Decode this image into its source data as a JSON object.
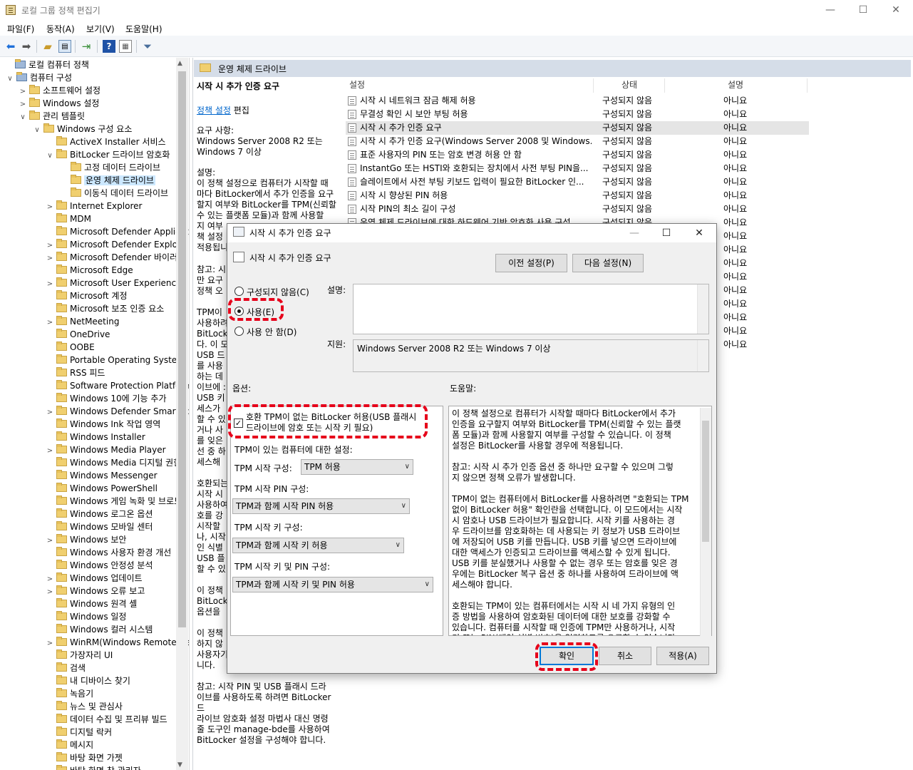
{
  "window": {
    "title": "로컬 그룹 정책 편집기",
    "min_glyph": "—",
    "max_glyph": "☐",
    "close_glyph": "✕"
  },
  "menu": [
    "파일(F)",
    "동작(A)",
    "보기(V)",
    "도움말(H)"
  ],
  "toolbar_icons": [
    "back-arrow-icon",
    "forward-arrow-icon",
    "up-folder-icon",
    "show-hide-tree-icon",
    "export-list-icon",
    "help-icon",
    "properties-icon",
    "filter-icon"
  ],
  "tree": [
    {
      "label": "로컬 컴퓨터 정책",
      "level": 0,
      "exp": ""
    },
    {
      "label": "컴퓨터 구성",
      "level": 1,
      "exp": "∨"
    },
    {
      "label": "소프트웨어 설정",
      "level": 2,
      "exp": ">"
    },
    {
      "label": "Windows 설정",
      "level": 2,
      "exp": ">"
    },
    {
      "label": "관리 템플릿",
      "level": 2,
      "exp": "∨"
    },
    {
      "label": "Windows 구성 요소",
      "level": 3,
      "exp": "∨"
    },
    {
      "label": "ActiveX Installer 서비스",
      "level": 4,
      "exp": ""
    },
    {
      "label": "BitLocker 드라이브 암호화",
      "level": 4,
      "exp": "∨"
    },
    {
      "label": "고정 데이터 드라이브",
      "level": 5,
      "exp": ""
    },
    {
      "label": "운영 체제 드라이브",
      "level": 5,
      "exp": "",
      "selected": true
    },
    {
      "label": "이동식 데이터 드라이브",
      "level": 5,
      "exp": ""
    },
    {
      "label": "Internet Explorer",
      "level": 4,
      "exp": ">"
    },
    {
      "label": "MDM",
      "level": 4,
      "exp": ""
    },
    {
      "label": "Microsoft Defender Application",
      "level": 4,
      "exp": ""
    },
    {
      "label": "Microsoft Defender Exploit",
      "level": 4,
      "exp": ">"
    },
    {
      "label": "Microsoft Defender 바이러",
      "level": 4,
      "exp": ">"
    },
    {
      "label": "Microsoft Edge",
      "level": 4,
      "exp": ""
    },
    {
      "label": "Microsoft User Experience",
      "level": 4,
      "exp": ">"
    },
    {
      "label": "Microsoft 계정",
      "level": 4,
      "exp": ""
    },
    {
      "label": "Microsoft 보조 인증 요소",
      "level": 4,
      "exp": ""
    },
    {
      "label": "NetMeeting",
      "level": 4,
      "exp": ">"
    },
    {
      "label": "OneDrive",
      "level": 4,
      "exp": ""
    },
    {
      "label": "OOBE",
      "level": 4,
      "exp": ""
    },
    {
      "label": "Portable Operating System",
      "level": 4,
      "exp": ""
    },
    {
      "label": "RSS 피드",
      "level": 4,
      "exp": ""
    },
    {
      "label": "Software Protection Platform",
      "level": 4,
      "exp": ""
    },
    {
      "label": "Windows 10에 기능 추가",
      "level": 4,
      "exp": ""
    },
    {
      "label": "Windows Defender SmartScreen",
      "level": 4,
      "exp": ">"
    },
    {
      "label": "Windows Ink 작업 영역",
      "level": 4,
      "exp": ""
    },
    {
      "label": "Windows Installer",
      "level": 4,
      "exp": ""
    },
    {
      "label": "Windows Media Player",
      "level": 4,
      "exp": ">"
    },
    {
      "label": "Windows Media 디지털 권한",
      "level": 4,
      "exp": ""
    },
    {
      "label": "Windows Messenger",
      "level": 4,
      "exp": ""
    },
    {
      "label": "Windows PowerShell",
      "level": 4,
      "exp": ""
    },
    {
      "label": "Windows 게임 녹화 및 브로드",
      "level": 4,
      "exp": ""
    },
    {
      "label": "Windows 로그온 옵션",
      "level": 4,
      "exp": ""
    },
    {
      "label": "Windows 모바일 센터",
      "level": 4,
      "exp": ""
    },
    {
      "label": "Windows 보안",
      "level": 4,
      "exp": ">"
    },
    {
      "label": "Windows 사용자 환경 개선",
      "level": 4,
      "exp": ""
    },
    {
      "label": "Windows 안정성 분석",
      "level": 4,
      "exp": ""
    },
    {
      "label": "Windows 업데이트",
      "level": 4,
      "exp": ">"
    },
    {
      "label": "Windows 오류 보고",
      "level": 4,
      "exp": ">"
    },
    {
      "label": "Windows 원격 셸",
      "level": 4,
      "exp": ""
    },
    {
      "label": "Windows 일정",
      "level": 4,
      "exp": ""
    },
    {
      "label": "Windows 컬러 시스템",
      "level": 4,
      "exp": ""
    },
    {
      "label": "WinRM(Windows Remote Management)",
      "level": 4,
      "exp": ">"
    },
    {
      "label": "가장자리 UI",
      "level": 4,
      "exp": ""
    },
    {
      "label": "검색",
      "level": 4,
      "exp": ""
    },
    {
      "label": "내 디바이스 찾기",
      "level": 4,
      "exp": ""
    },
    {
      "label": "녹음기",
      "level": 4,
      "exp": ""
    },
    {
      "label": "뉴스 및 관심사",
      "level": 4,
      "exp": ""
    },
    {
      "label": "데이터 수집 및 프리뷰 빌드",
      "level": 4,
      "exp": ""
    },
    {
      "label": "디지털 락커",
      "level": 4,
      "exp": ""
    },
    {
      "label": "메시지",
      "level": 4,
      "exp": ""
    },
    {
      "label": "바탕 화면 가젯",
      "level": 4,
      "exp": ""
    },
    {
      "label": "바탕 화면 창 관리자",
      "level": 4,
      "exp": ""
    }
  ],
  "content": {
    "folder_title": "운영 체제 드라이브",
    "desc_title": "시작 시 추가 인증 요구",
    "edit_link": "정책 설정",
    "edit_suffix": " 편집",
    "desc_req": "요구 사항:\nWindows Server 2008 R2 또는\nWindows 7 이상",
    "desc_body": "설명:\n이 정책 설정으로 컴퓨터가 시작할 때\n마다 BitLocker에서 추가 인증을 요구\n할지 여부와 BitLocker를 TPM(신뢰할\n수 있는 플랫폼 모듈)과 함께 사용할\n지 여부\n책 설정\n적용됩니",
    "desc_note": "참고: 시\n만 요구\n정책 오",
    "desc_tpm": "TPM이\n사용하려\nBitLock\n다. 이 모\nUSB 드\n를 사용\n하는 데\n이브에 :\nUSB 키\n세스가\n할 수 있\n거나 사\n를 잊은\n선 중 하\n세스해",
    "desc_compat": "호환되는\n시작 시\n사용하여\n호를 강\n시작할 \n나, 시작\n인 식별\nUSB 플\n할 수 있",
    "desc_tail1": "이 정책\nBitLock\n옵션을 ",
    "desc_tail2": "이 정책\n하지 않\n사용자기\n니다.",
    "desc_final": "참고: 시작 PIN 및 USB 플래시 드라\n이브를 사용하도록 하려면 BitLocker 드\n라이브 암호화 설정 마법사 대신 명령\n줄 도구인 manage-bde를 사용하여\nBitLocker 설정을 구성해야 합니다."
  },
  "columns": {
    "setting": "설정",
    "state": "상태",
    "comment": "설명"
  },
  "rows": [
    {
      "name": "시작 시 네트워크 잠금 해제 허용",
      "state": "구성되지 않음",
      "comment": "아니요"
    },
    {
      "name": "무결성 확인 시 보안 부팅 허용",
      "state": "구성되지 않음",
      "comment": "아니요"
    },
    {
      "name": "시작 시 추가 인증 요구",
      "state": "구성되지 않음",
      "comment": "아니요",
      "selected": true
    },
    {
      "name": "시작 시 추가 인증 요구(Windows Server 2008 및 Windows...",
      "state": "구성되지 않음",
      "comment": "아니요"
    },
    {
      "name": "표준 사용자의 PIN 또는 암호 변경 허용 안 함",
      "state": "구성되지 않음",
      "comment": "아니요"
    },
    {
      "name": "InstantGo 또는 HSTI와 호환되는 장치에서 사전 부팅 PIN을...",
      "state": "구성되지 않음",
      "comment": "아니요"
    },
    {
      "name": "슬레이트에서 사전 부팅 키보드 입력이 필요한 BitLocker 인...",
      "state": "구성되지 않음",
      "comment": "아니요"
    },
    {
      "name": "시작 시 향상된 PIN 허용",
      "state": "구성되지 않음",
      "comment": "아니요"
    },
    {
      "name": "시작 PIN의 최소 길이 구성",
      "state": "구성되지 않음",
      "comment": "아니요"
    },
    {
      "name": "운영 체제 드라이브에 대한 하드웨어 기반 암호화 사용 구성",
      "state": "구성되지 않음",
      "comment": "아니요"
    },
    {
      "name": "",
      "state": "",
      "comment": "아니요"
    },
    {
      "name": "",
      "state": "",
      "comment": "아니요"
    },
    {
      "name": "",
      "state": "",
      "comment": "아니요"
    },
    {
      "name": "",
      "state": "",
      "comment": "아니요"
    },
    {
      "name": "",
      "state": "",
      "comment": "아니요"
    },
    {
      "name": "",
      "state": "",
      "comment": "아니요"
    },
    {
      "name": "",
      "state": "",
      "comment": "아니요"
    },
    {
      "name": "",
      "state": "",
      "comment": "아니요"
    },
    {
      "name": "",
      "state": "",
      "comment": "아니요"
    }
  ],
  "dialog": {
    "title": "시작 시 추가 인증 요구",
    "heading": "시작 시 추가 인증 요구",
    "prev_button": "이전 설정(P)",
    "next_button": "다음 설정(N)",
    "radio_not_configured": "구성되지 않음(C)",
    "radio_enabled": "사용(E)",
    "radio_disabled": "사용 안 함(D)",
    "selected_radio": "enabled",
    "comment_label": "설명:",
    "comment_value": "",
    "support_label": "지원:",
    "support_value": "Windows Server 2008 R2 또는 Windows 7 이상",
    "options_label": "옵션:",
    "help_label": "도움말:",
    "allow_no_tpm_line1": "호환 TPM이 없는 BitLocker 허용(USB 플래시",
    "allow_no_tpm_line2": "드라이브에 암호 또는 시작 키 필요)",
    "allow_no_tpm_checked": true,
    "tpm_settings_heading": "TPM이 있는 컴퓨터에 대한 설정:",
    "tpm_startup_label": "TPM 시작 구성:",
    "tpm_startup_value": "TPM 허용",
    "tpm_pin_label": "TPM 시작 PIN 구성:",
    "tpm_pin_value": "TPM과 함께 시작 PIN 허용",
    "tpm_key_label": "TPM 시작 키 구성:",
    "tpm_key_value": "TPM과 함께 시작 키 허용",
    "tpm_key_pin_label": "TPM 시작 키 및 PIN 구성:",
    "tpm_key_pin_value": "TPM과 함께 시작 키 및 PIN 허용",
    "help_text": "이 정책 설정으로 컴퓨터가 시작할 때마다 BitLocker에서 추가\n인증을 요구할지 여부와 BitLocker를 TPM(신뢰할 수 있는 플랫\n폼 모듈)과 함께 사용할지 여부를 구성할 수 있습니다. 이 정책\n설정은 BitLocker를 사용할 경우에 적용됩니다.\n\n참고: 시작 시 추가 인증 옵션 중 하나만 요구할 수 있으며 그렇\n지 않으면 정책 오류가 발생합니다.\n\nTPM이 없는 컴퓨터에서 BitLocker를 사용하려면 \"호환되는 TPM\n없이 BitLocker 허용\" 확인란을 선택합니다. 이 모드에서는 시작\n시 암호나 USB 드라이브가 필요합니다. 시작 키를 사용하는 경\n우 드라이브를 암호화하는 데 사용되는 키 정보가 USB 드라이브\n에 저장되어 USB 키를 만듭니다. USB 키를 넣으면 드라이브에\n대한 액세스가 인증되고 드라이브를 액세스할 수 있게 됩니다.\nUSB 키를 분실했거나 사용할 수 없는 경우 또는 암호를 잊은 경\n우에는 BitLocker 복구 옵션 중 하나를 사용하여 드라이브에 액\n세스해야 합니다.\n\n호환되는 TPM이 있는 컴퓨터에서는 시작 시 네 가지 유형의 인\n증 방법을 사용하여 암호화된 데이터에 대한 보호를 강화할 수\n있습니다. 컴퓨터를 시작할 때 인증에 TPM만 사용하거나, 시작\n키 또는 PIN(개인 식별 번호)을 입력하도록 요구할 수 있습니다.",
    "ok_button": "확인",
    "cancel_button": "취소",
    "apply_button": "적용(A)"
  },
  "highlight_color": "#e6001a"
}
